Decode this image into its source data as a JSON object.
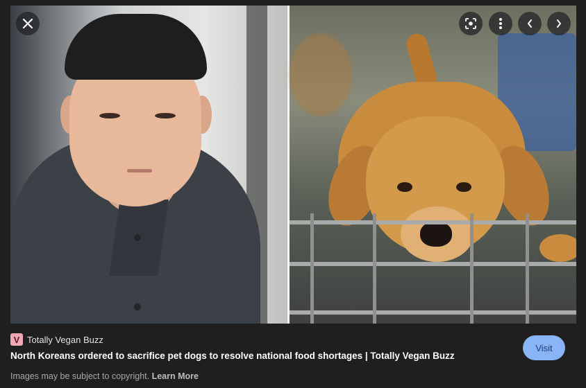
{
  "controls": {
    "close_icon": "close-icon",
    "lens_icon": "lens-icon",
    "more_icon": "more-vert-icon",
    "prev_icon": "chevron-left-icon",
    "next_icon": "chevron-right-icon"
  },
  "result": {
    "favicon_letter": "V",
    "source_name": "Totally Vegan Buzz",
    "title": "North Koreans ordered to sacrifice pet dogs to resolve national food shortages | Totally Vegan Buzz",
    "visit_label": "Visit",
    "copyright_text": "Images may be subject to copyright.",
    "learn_more_label": "Learn More"
  },
  "colors": {
    "background": "#1f1f1f",
    "visit_button": "#8ab4f8",
    "favicon": "#f1a9b6"
  }
}
